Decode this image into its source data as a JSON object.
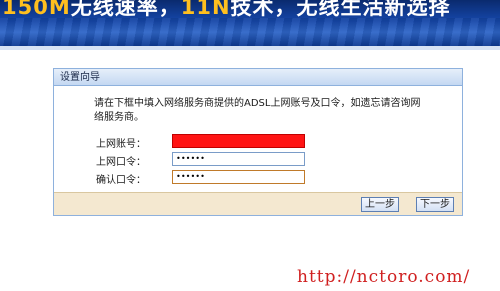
{
  "banner": {
    "prefix": "150M",
    "text1": "无线速率，",
    "accent": "11N",
    "text2": "技术，无线生活新选择"
  },
  "dialog": {
    "title": "设置向导",
    "intro": "请在下框中填入网络服务商提供的ADSL上网账号及口令，如遗忘请咨询网络服务商。",
    "fields": [
      {
        "label": "上网账号：",
        "value": ""
      },
      {
        "label": "上网口令：",
        "value": "••••••"
      },
      {
        "label": "确认口令：",
        "value": "••••••"
      }
    ],
    "buttons": {
      "prev": "上一步",
      "next": "下一步"
    }
  },
  "watermark": "http://nctoro.com/"
}
